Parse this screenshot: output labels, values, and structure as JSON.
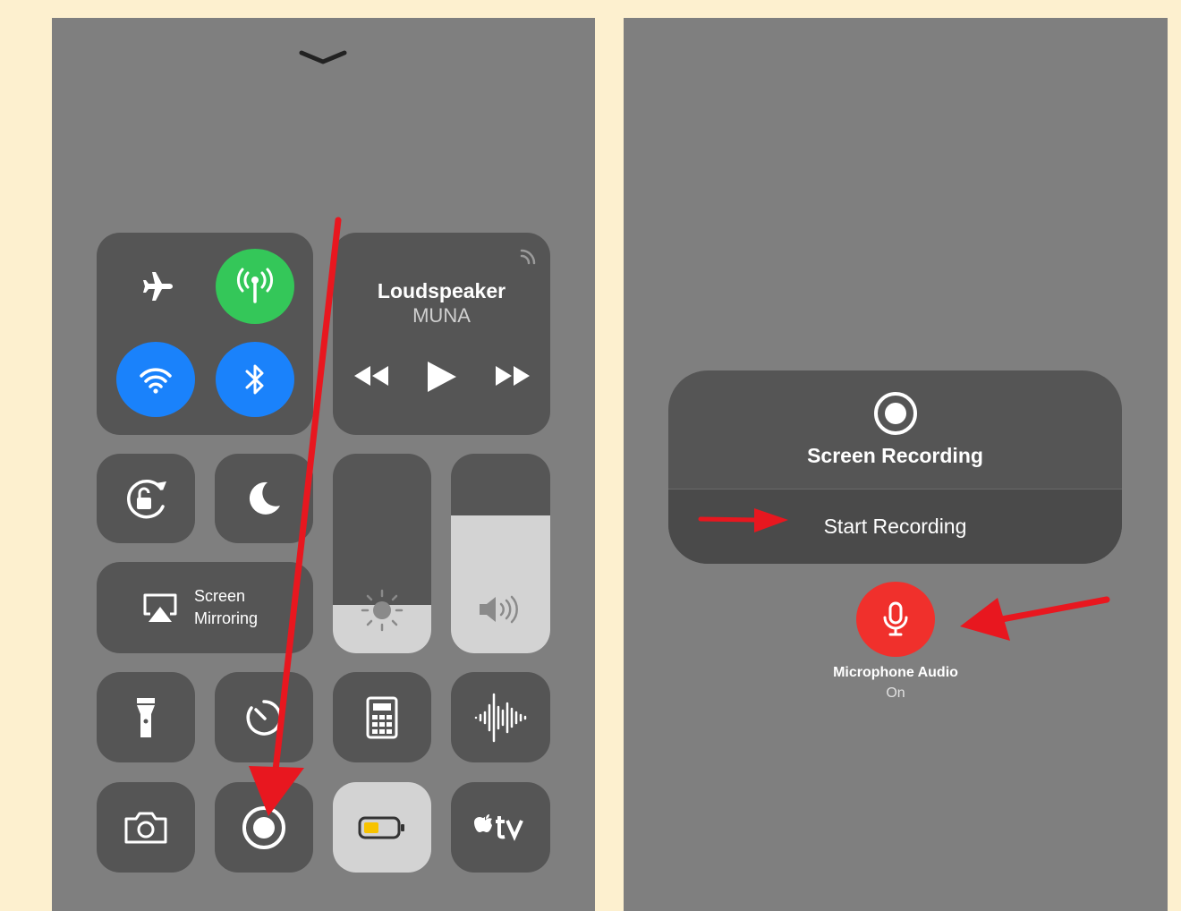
{
  "left_panel": {
    "media": {
      "title": "Loudspeaker",
      "subtitle": "MUNA",
      "airplay_icon": "airplay-icon",
      "rewind_icon": "rewind-icon",
      "play_icon": "play-icon",
      "forward_icon": "fast-forward-icon"
    },
    "connectivity": {
      "airplane": {
        "icon": "airplane-icon",
        "color": "#555555"
      },
      "cellular": {
        "icon": "cellular-antenna-icon",
        "color": "#34c759"
      },
      "wifi": {
        "icon": "wifi-icon",
        "color": "#1a82fb"
      },
      "bluetooth": {
        "icon": "bluetooth-icon",
        "color": "#1a82fb"
      }
    },
    "screen_mirroring": {
      "line1": "Screen",
      "line2": "Mirroring"
    },
    "brightness_level": 0.24,
    "volume_level": 0.69,
    "annotation_arrow_color": "#e8171f"
  },
  "right_panel": {
    "screen_recording": {
      "title": "Screen Recording",
      "start_label": "Start Recording"
    },
    "microphone": {
      "label": "Microphone Audio",
      "status": "On",
      "color": "#f0302c"
    },
    "annotation_arrow_color": "#e8171f"
  }
}
